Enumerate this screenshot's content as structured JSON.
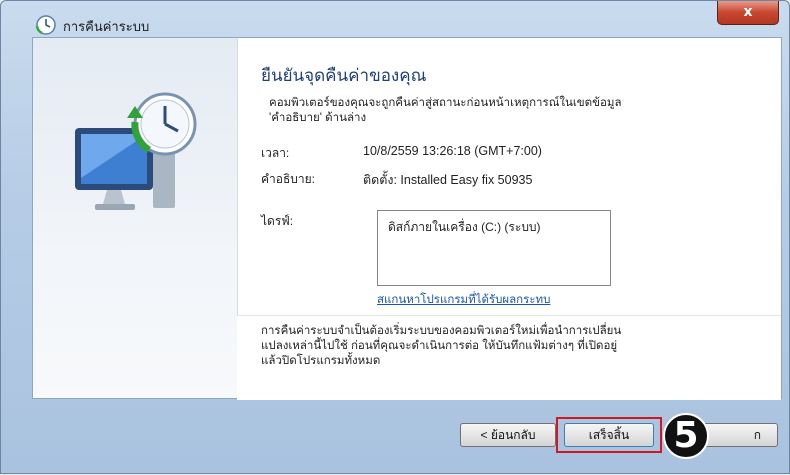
{
  "window": {
    "title": "การคืนค่าระบบ",
    "close_label": "x"
  },
  "main": {
    "heading": "ยืนยันจุดคืนค่าของคุณ",
    "intro_line1": "คอมพิวเตอร์ของคุณจะถูกคืนค่าสู่สถานะก่อนหน้าเหตุการณ์ในเขตข้อมูล",
    "intro_line2": "'คำอธิบาย' ด้านล่าง",
    "time_label": "เวลา:",
    "time_value": "10/8/2559 13:26:18 (GMT+7:00)",
    "description_label": "คำอธิบาย:",
    "description_value": "ติดตั้ง: Installed Easy fix 50935",
    "drives_label": "ไดรฟ์:",
    "drives": [
      "ดิสก์ภายในเครื่อง (C:) (ระบบ)"
    ],
    "scan_link": "สแกนหาโปรแกรมที่ได้รับผลกระทบ",
    "warning_line1": "การคืนค่าระบบจำเป็นต้องเริ่มระบบของคอมพิวเตอร์ใหม่เพื่อนำการเปลี่ยน",
    "warning_line2": "แปลงเหล่านี้ไปใช้ ก่อนที่คุณจะดำเนินการต่อ ให้บันทึกแฟ้มต่างๆ ที่เปิดอยู่",
    "warning_line3": "แล้วปิดโปรแกรมทั้งหมด"
  },
  "footer": {
    "back_label": "< ย้อนกลับ",
    "finish_label": "เสร็จสิ้น",
    "cancel_label": "ก",
    "step_number": "5"
  },
  "colors": {
    "heading": "#1f3f75",
    "link": "#1a55b4",
    "highlight": "#d0181f",
    "close_button": "#c7472f"
  },
  "icons": {
    "title": "system-restore-icon",
    "illustration": "system-restore-illustration"
  }
}
